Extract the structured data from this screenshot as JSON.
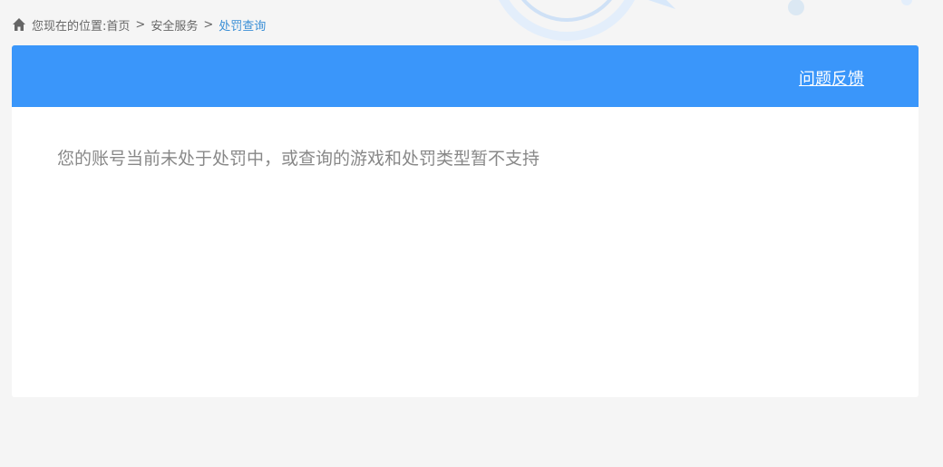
{
  "breadcrumb": {
    "prefix": "您现在的位置:",
    "items": [
      {
        "label": "首页"
      },
      {
        "label": "安全服务"
      },
      {
        "label": "处罚查询"
      }
    ],
    "separator": ">"
  },
  "header": {
    "feedback_label": "问题反馈"
  },
  "main": {
    "message": "您的账号当前未处于处罚中，或查询的游戏和处罚类型暂不支持"
  },
  "icons": {
    "home": "home-icon"
  },
  "colors": {
    "header_bg": "#3a96fa",
    "link_current": "#3a8fd6",
    "page_bg": "#f5f5f5",
    "message_text": "#888888"
  }
}
